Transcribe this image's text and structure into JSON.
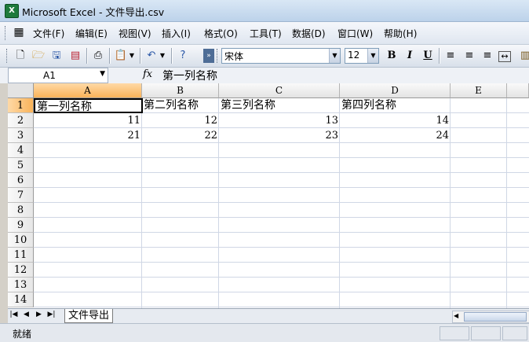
{
  "window": {
    "title": "Microsoft Excel - 文件导出.csv",
    "app_icon": "excel-app-icon"
  },
  "menu": {
    "items": [
      "文件(F)",
      "编辑(E)",
      "视图(V)",
      "插入(I)",
      "格式(O)",
      "工具(T)",
      "数据(D)",
      "窗口(W)",
      "帮助(H)"
    ]
  },
  "toolbar": {
    "font_name": "宋体",
    "font_size": "12",
    "bold": "B",
    "italic": "I",
    "underline": "U"
  },
  "formula_bar": {
    "name_box": "A1",
    "fx": "fx",
    "content": "第一列名称"
  },
  "sheet": {
    "columns": [
      "A",
      "B",
      "C",
      "D",
      "E"
    ],
    "rows": [
      "1",
      "2",
      "3",
      "4",
      "5",
      "6",
      "7",
      "8",
      "9",
      "10",
      "11",
      "12",
      "13",
      "14"
    ],
    "cells": [
      [
        "第一列名称",
        "第二列名称",
        "第三列名称",
        "第四列名称"
      ],
      [
        "11",
        "12",
        "13",
        "14"
      ],
      [
        "21",
        "22",
        "23",
        "24"
      ]
    ],
    "selected_cell": "A1"
  },
  "tabs": {
    "sheet_name": "文件导出"
  },
  "status": {
    "text": "就绪"
  },
  "colors": {
    "header_active": "#f9b35a",
    "grid_line": "#d0d7e5",
    "excel_green": "#1d7a3c"
  }
}
